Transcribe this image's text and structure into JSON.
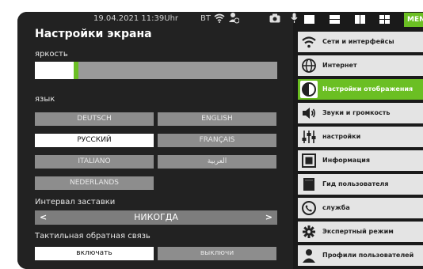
{
  "status_bar": {
    "datetime": "19.04.2021 11:39Uhr",
    "bt_label": "BT"
  },
  "screen": {
    "title": "Настройки экрана",
    "brightness_label": "яркость",
    "brightness_level_pct": 17,
    "language_label": "язык",
    "languages": [
      {
        "label": "DEUTSCH",
        "selected": false
      },
      {
        "label": "ENGLISH",
        "selected": false
      },
      {
        "label": "РУССКИЙ",
        "selected": true
      },
      {
        "label": "FRANÇAIS",
        "selected": false
      },
      {
        "label": "ITALIANO",
        "selected": false
      },
      {
        "label": "العربية",
        "selected": false
      },
      {
        "label": "NEDERLANDS",
        "selected": false
      }
    ],
    "screensaver_label": "Интервал заставки",
    "screensaver_value": "НИКОГДА",
    "haptic_label": "Тактильная обратная связь",
    "haptic_on": "включать",
    "haptic_off": "выключи",
    "haptic_enabled": true
  },
  "menu": {
    "tab_label": "MEN",
    "items": [
      {
        "label": "Сети и интерфейсы",
        "icon": "wifi-icon",
        "active": false
      },
      {
        "label": "Интернет",
        "icon": "globe-icon",
        "active": false
      },
      {
        "label": "Настройки отображения",
        "icon": "contrast-icon",
        "active": true
      },
      {
        "label": "Звуки и громкость",
        "icon": "speaker-icon",
        "active": false
      },
      {
        "label": "настройки",
        "icon": "sliders-icon",
        "active": false
      },
      {
        "label": "Информация",
        "icon": "info-icon",
        "active": false
      },
      {
        "label": "Гид пользователя",
        "icon": "book-icon",
        "active": false
      },
      {
        "label": "служба",
        "icon": "phone-icon",
        "active": false
      },
      {
        "label": "Экспертный режим",
        "icon": "gear-icon",
        "active": false
      },
      {
        "label": "Профили пользователей",
        "icon": "user-icon",
        "active": false
      }
    ]
  },
  "colors": {
    "accent": "#6bbf23",
    "panel_bg": "#222222",
    "menu_bg": "#e4e4e4"
  }
}
